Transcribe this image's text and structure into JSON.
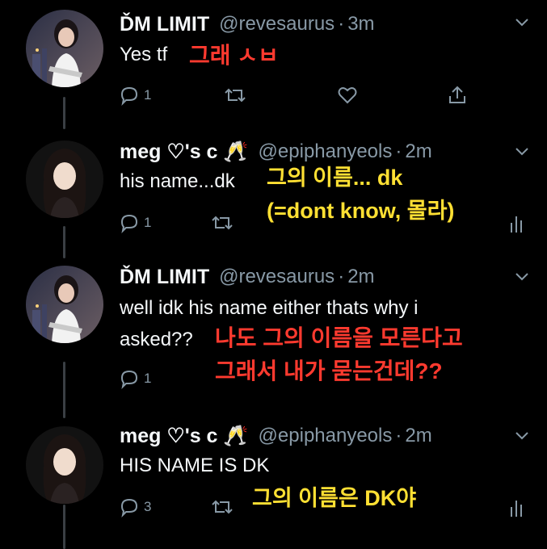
{
  "tweets": [
    {
      "name": "ĎM LIMIT",
      "handle": "@revesaurus",
      "separator": "·",
      "time": "3m",
      "text_lines": [
        "Yes tf"
      ],
      "reply_count": "1",
      "avatar_icon": "user-avatar-icon"
    },
    {
      "name": "meg ♡'s c 🥂",
      "handle": "@epiphanyeols",
      "separator": "·",
      "time": "2m",
      "text_lines": [
        "his name...dk"
      ],
      "reply_count": "1",
      "avatar_icon": "user-avatar-icon"
    },
    {
      "name": "ĎM LIMIT",
      "handle": "@revesaurus",
      "separator": "·",
      "time": "2m",
      "text_lines": [
        "well idk his name either thats why i",
        "asked??"
      ],
      "reply_count": "1",
      "avatar_icon": "user-avatar-icon"
    },
    {
      "name": "meg ♡'s c 🥂",
      "handle": "@epiphanyeols",
      "separator": "·",
      "time": "2m",
      "text_lines": [
        "HIS NAME IS DK"
      ],
      "reply_count": "3",
      "avatar_icon": "user-avatar-icon"
    }
  ],
  "translations": {
    "t1": "그래 ㅅㅂ",
    "t2_line1": "그의 이름... dk",
    "t2_line2": "(=dont know, 몰라)",
    "t3_line1": "나도 그의 이름을 모른다고",
    "t3_line2": "그래서 내가 묻는건데??",
    "t4": "그의 이름은 DK야"
  },
  "colors": {
    "background": "#000000",
    "muted": "#8899a6",
    "red_caption": "#ff3a2f",
    "yellow_caption": "#ffe033"
  }
}
